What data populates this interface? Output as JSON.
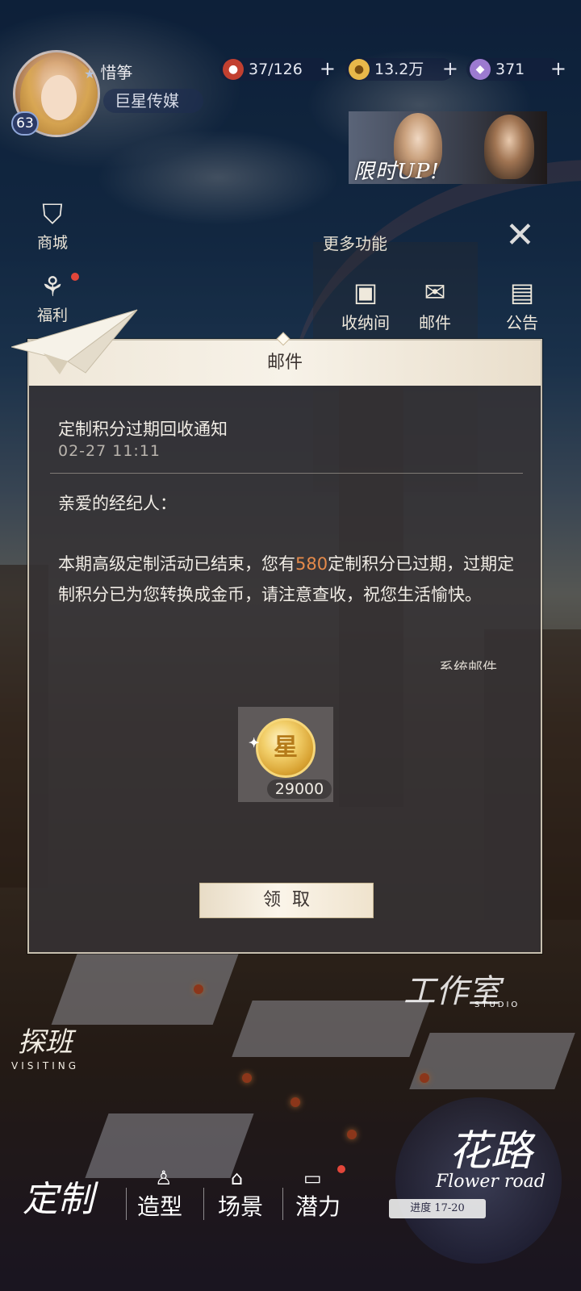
{
  "hud": {
    "player_name": "惜筝",
    "company": "巨星传媒",
    "level": "63",
    "stamina": "37/126",
    "gold": "13.2万",
    "diamond": "371",
    "promo_label": "限时UP!"
  },
  "side_menu": {
    "shop": "商城",
    "welfare": "福利"
  },
  "more_functions": {
    "title": "更多功能",
    "items": [
      "收纳间",
      "邮件",
      "公告"
    ]
  },
  "dialog": {
    "header": "邮件",
    "mail_title": "定制积分过期回收通知",
    "mail_date": "02-27 11:11",
    "greeting": "亲爱的经纪人：",
    "body_before": "本期高级定制活动已结束，您有",
    "body_highlight": "580",
    "body_after": "定制积分已过期，过期定制积分已为您转换成金币，请注意查收，祝您生活愉快。",
    "signature": "系统邮件",
    "reward_icon_text": "星",
    "reward_count": "29000",
    "claim_label": "领取"
  },
  "bottom": {
    "studio": "工作室",
    "studio_sub": "STUDIO",
    "visit": "探班",
    "visit_sub": "VISITING",
    "flower": "花路",
    "flower_en": "Flower road",
    "progress": "进度 17-20",
    "nav": [
      "定制",
      "造型",
      "场景",
      "潜力"
    ]
  },
  "colors": {
    "highlight": "#e58a4a",
    "dialog_bg": "#363234",
    "dialog_border": "#e2d8c4"
  }
}
